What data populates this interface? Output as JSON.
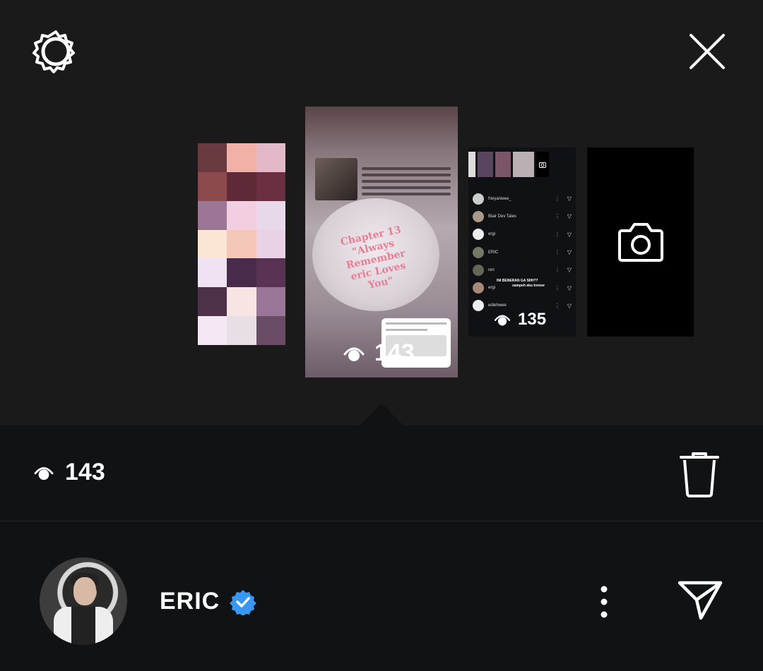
{
  "top_bar": {
    "settings_icon": "gear-icon",
    "close_icon": "close-icon"
  },
  "stories": {
    "current": {
      "views": "143",
      "cake_text": "Chapter 13 \"Always Remember eric Loves You\""
    },
    "next": {
      "views": "135",
      "viewer_list": [
        "frieyanieee_",
        "Blair Dev Tales",
        "ergi",
        "ERIC",
        "ren",
        "ergi",
        "ediehwee"
      ],
      "overlay_line1": "INI BENERAN GA SIIH??",
      "overlay_line2": "sampeh aku tremor"
    },
    "add_story_icon": "camera-icon"
  },
  "insights_bar": {
    "views": "143",
    "eye_icon": "eye-icon",
    "delete_icon": "trash-icon"
  },
  "profile": {
    "username": "ERIC",
    "verified": true,
    "verified_color": "#3897f0",
    "more_icon": "more-vertical-icon",
    "share_icon": "send-icon"
  },
  "colors": {
    "background_top": "#1a1a1b",
    "background_bottom": "#111214"
  }
}
